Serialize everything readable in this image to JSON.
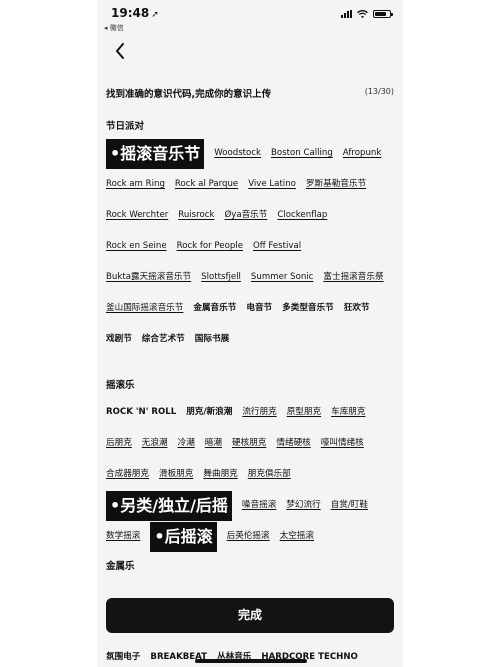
{
  "status_bar": {
    "time": "19:48",
    "nav_arrow": "➚",
    "back_label": "◂ 微信"
  },
  "back_icon": "chevron-left-icon",
  "header": {
    "instruction": "找到准确的意识代码,完成你的意识上传",
    "counter": "(13/30)"
  },
  "sections": [
    {
      "title": "节日派对",
      "tags": [
        {
          "label": "•摇滚音乐节",
          "selected": true
        },
        {
          "label": "Woodstock"
        },
        {
          "label": "Boston Calling"
        },
        {
          "label": "Afropunk"
        },
        {
          "label": "Rock am Ring"
        },
        {
          "label": "Rock al Parque"
        },
        {
          "label": "Vive Latino"
        },
        {
          "label": "罗斯基勒音乐节"
        },
        {
          "label": "Rock Werchter"
        },
        {
          "label": "Ruisrock"
        },
        {
          "label": "Øya音乐节"
        },
        {
          "label": "Clockenflap"
        },
        {
          "label": "Rock en Seine"
        },
        {
          "label": "Rock for People"
        },
        {
          "label": "Off Festival"
        },
        {
          "label": "Bukta露天摇滚音乐节"
        },
        {
          "label": "Slottsfjell"
        },
        {
          "label": "Summer Sonic"
        },
        {
          "label": "富士摇滚音乐祭"
        },
        {
          "label": "釜山国际摇滚音乐节"
        },
        {
          "label": "金属音乐节",
          "plain": true
        },
        {
          "label": "电音节",
          "plain": true
        },
        {
          "label": "多类型音乐节",
          "plain": true
        },
        {
          "label": "狂欢节",
          "plain": true
        },
        {
          "label": "戏剧节",
          "plain": true
        },
        {
          "label": "综合艺术节",
          "plain": true
        },
        {
          "label": "国际书展",
          "plain": true
        }
      ]
    },
    {
      "title": "摇滚乐",
      "tags": [
        {
          "label": "ROCK 'N' ROLL",
          "plain": true
        },
        {
          "label": "朋克/新浪潮",
          "plain": true
        },
        {
          "label": "流行朋克"
        },
        {
          "label": "原型朋克"
        },
        {
          "label": "车库朋克"
        },
        {
          "label": "后朋克"
        },
        {
          "label": "无浪潮"
        },
        {
          "label": "冷潮"
        },
        {
          "label": "暗潮"
        },
        {
          "label": "硬核朋克"
        },
        {
          "label": "情绪硬核"
        },
        {
          "label": "嚎叫情绪核"
        },
        {
          "label": "合成器朋克"
        },
        {
          "label": "滑板朋克"
        },
        {
          "label": "舞曲朋克"
        },
        {
          "label": "朋克俱乐部"
        },
        {
          "label": "•另类/独立/后摇",
          "selected": true
        },
        {
          "label": "噪音摇滚"
        },
        {
          "label": "梦幻流行"
        },
        {
          "label": "自赏/盯鞋"
        },
        {
          "label": "数学摇滚"
        },
        {
          "label": "•后摇滚",
          "selected": true
        },
        {
          "label": "后英伦摇滚"
        },
        {
          "label": "太空摇滚"
        }
      ]
    },
    {
      "title": "金属乐",
      "tags": []
    }
  ],
  "done_button": "完成",
  "bottom_tags": [
    {
      "label": "氛围电子"
    },
    {
      "label": "BREAKBEAT"
    },
    {
      "label": "丛林音乐"
    },
    {
      "label": "HARDCORE TECHNO"
    }
  ],
  "colors": {
    "page_bg": "#f4f4f4",
    "selected_bg": "#0f0f0f",
    "button_bg": "#131313",
    "text": "#111111"
  }
}
